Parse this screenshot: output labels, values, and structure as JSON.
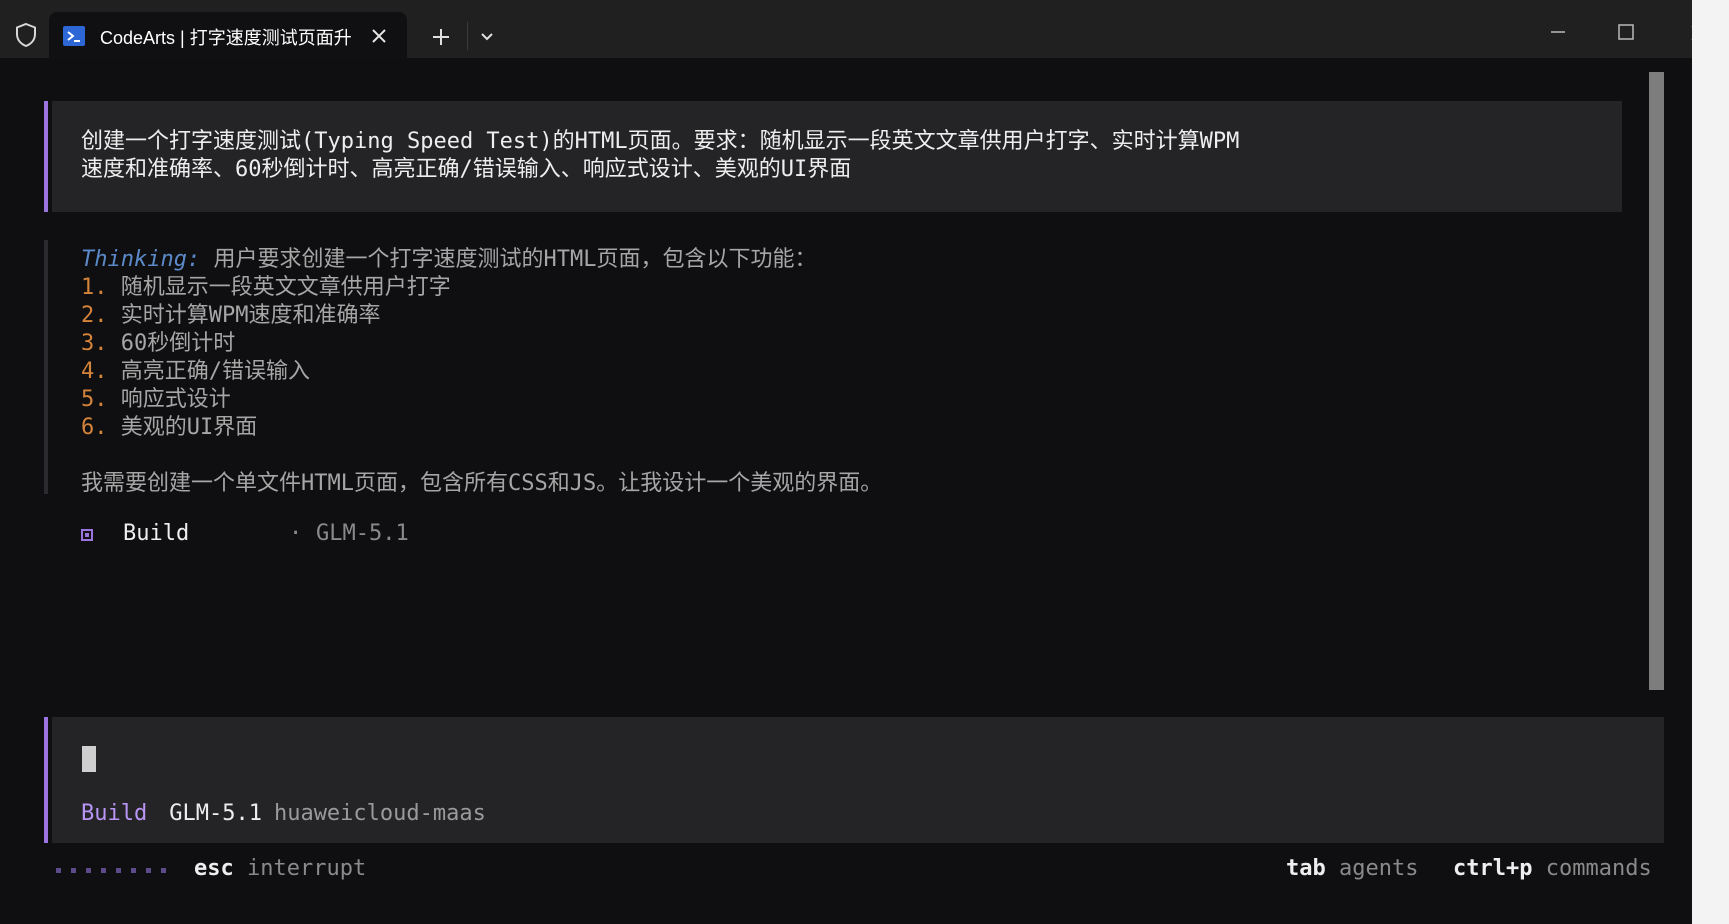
{
  "tab": {
    "title": "CodeArts | 打字速度测试页面升",
    "icon": "terminal-icon"
  },
  "prompt": {
    "line1": "创建一个打字速度测试(Typing Speed Test)的HTML页面。要求：随机显示一段英文文章供用户打字、实时计算WPM",
    "line2": "速度和准确率、60秒倒计时、高亮正确/错误输入、响应式设计、美观的UI界面"
  },
  "thinking": {
    "label": "Thinking:",
    "intro": " 用户要求创建一个打字速度测试的HTML页面，包含以下功能：",
    "items": [
      {
        "num": "1.",
        "text": " 随机显示一段英文文章供用户打字"
      },
      {
        "num": "2.",
        "text": " 实时计算WPM速度和准确率"
      },
      {
        "num": "3.",
        "text": " 60秒倒计时"
      },
      {
        "num": "4.",
        "text": " 高亮正确/错误输入"
      },
      {
        "num": "5.",
        "text": " 响应式设计"
      },
      {
        "num": "6.",
        "text": " 美观的UI界面"
      }
    ],
    "conclusion": "我需要创建一个单文件HTML页面，包含所有CSS和JS。让我设计一个美观的界面。"
  },
  "build_status": {
    "agent": "Build",
    "separator": "·",
    "model": "GLM-5.1"
  },
  "input": {
    "agent": "Build",
    "model": "GLM-5.1",
    "provider": "huaweicloud-maas"
  },
  "footer": {
    "esc_key": "esc",
    "esc_desc": "interrupt",
    "tab_key": "tab",
    "tab_desc": "agents",
    "cmd_key": "ctrl+p",
    "cmd_desc": "commands"
  },
  "colors": {
    "accent": "#9b74e0",
    "agent_label": "#b996f5",
    "thinking_label": "#5b89c7",
    "list_number": "#d4833a",
    "terminal_bg": "#0f0f11",
    "block_bg": "#242427"
  }
}
